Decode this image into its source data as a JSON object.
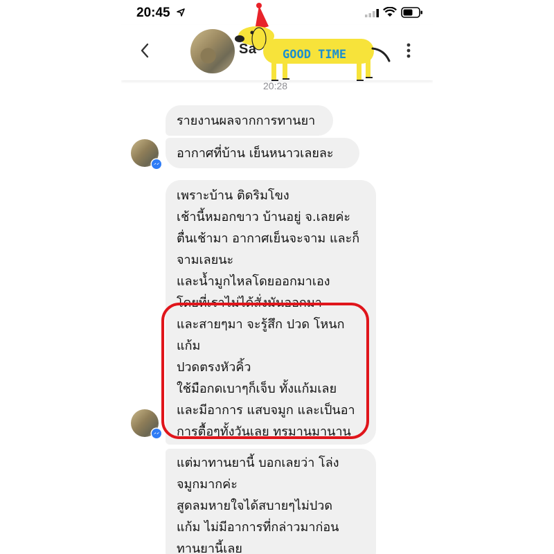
{
  "status_bar": {
    "time": "20:45"
  },
  "header": {
    "contact_name": "Sa",
    "sticker_text": "GOOD TIME"
  },
  "conversation": {
    "timestamp": "20:28",
    "messages": [
      {
        "lines": [
          "รายงานผลจากการทานยา"
        ]
      },
      {
        "lines": [
          "อากาศที่บ้าน เย็นหนาวเลยละ"
        ]
      },
      {
        "lines": [
          "เพราะบ้าน ติดริมโขง",
          "เช้านี้หมอกขาว บ้านอยู่ จ.เลยค่ะ",
          "ตื่นเช้ามา อากาศเย็นจะจาม และก็",
          "จามเลยนะ",
          "และน้ำมูกไหลโดยออกมาเอง",
          "โดยที่เราไม่ได้สั่งมันออกมา",
          "และสายๆมา จะรู้สึก ปวด โหนก",
          "แก้ม",
          "ปวดตรงหัวคิ้ว",
          "ใช้มือกดเบาๆก็เจ็บ ทั้งแก้มเลย",
          "และมีอาการ แสบจมูก และเป็นอา",
          "การตื้อๆทั้งวันเลย ทรมานมานาน"
        ]
      },
      {
        "lines": [
          "แต่มาทานยานี้ บอกเลยว่า โล่ง",
          "จมูกมากค่ะ",
          "สูดลมหายใจได้สบายๆไม่ปวด",
          "แก้ม ไม่มีอาการที่กล่าวมาก่อน",
          "ทานยานี้เลย"
        ]
      }
    ]
  },
  "colors": {
    "bubble": "#f0f0f0",
    "highlight": "#e0151b",
    "messenger_blue": "#2e7cf6",
    "sticker_yellow": "#f7e33a"
  },
  "icons": [
    "location-arrow-icon",
    "signal-icon",
    "wifi-icon",
    "battery-icon",
    "back-chevron-icon",
    "more-options-icon",
    "messenger-badge-icon"
  ]
}
